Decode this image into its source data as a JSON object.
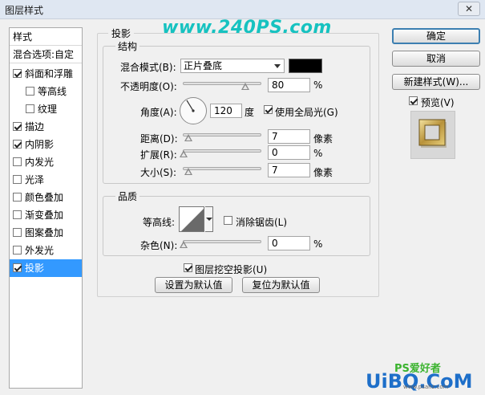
{
  "window": {
    "title": "图层样式",
    "close_glyph": "✕"
  },
  "watermark": "www.240PS.com",
  "sidebar": {
    "header1": "样式",
    "header2": "混合选项:自定",
    "items": [
      {
        "label": "斜面和浮雕",
        "checked": true
      },
      {
        "label": "等高线",
        "checked": false
      },
      {
        "label": "纹理",
        "checked": false
      },
      {
        "label": "描边",
        "checked": true
      },
      {
        "label": "内阴影",
        "checked": true
      },
      {
        "label": "内发光",
        "checked": false
      },
      {
        "label": "光泽",
        "checked": false
      },
      {
        "label": "颜色叠加",
        "checked": false
      },
      {
        "label": "渐变叠加",
        "checked": false
      },
      {
        "label": "图案叠加",
        "checked": false
      },
      {
        "label": "外发光",
        "checked": false
      },
      {
        "label": "投影",
        "checked": true
      }
    ],
    "selected": "投影"
  },
  "panel": {
    "title": "投影",
    "structure": {
      "legend": "结构",
      "blend_mode_label": "混合模式(B):",
      "blend_mode_value": "正片叠底",
      "shadow_color": "#000000",
      "opacity_label": "不透明度(O):",
      "opacity_value": "80",
      "opacity_unit": "%",
      "opacity_level": 0.8,
      "angle_label": "角度(A):",
      "angle_value": "120",
      "angle_unit": "度",
      "global_light_label": "使用全局光(G)",
      "global_light_checked": true,
      "distance_label": "距离(D):",
      "distance_value": "7",
      "distance_unit": "像素",
      "spread_label": "扩展(R):",
      "spread_value": "0",
      "spread_unit": "%",
      "size_label": "大小(S):",
      "size_value": "7",
      "size_unit": "像素"
    },
    "quality": {
      "legend": "品质",
      "contour_label": "等高线:",
      "anti_alias_label": "消除锯齿(L)",
      "anti_alias_checked": false,
      "noise_label": "杂色(N):",
      "noise_value": "0",
      "noise_unit": "%"
    },
    "knockout_label": "图层挖空投影(U)",
    "knockout_checked": true,
    "make_default": "设置为默认值",
    "reset_default": "复位为默认值"
  },
  "buttons": {
    "ok": "确定",
    "cancel": "取消",
    "new_style": "新建样式(W)...",
    "preview_label": "预览(V)",
    "preview_checked": true
  },
  "footer_watermark": {
    "brand": "PS爱好者",
    "site": "UiBQ.CoM",
    "small": "www.psahz.com"
  }
}
